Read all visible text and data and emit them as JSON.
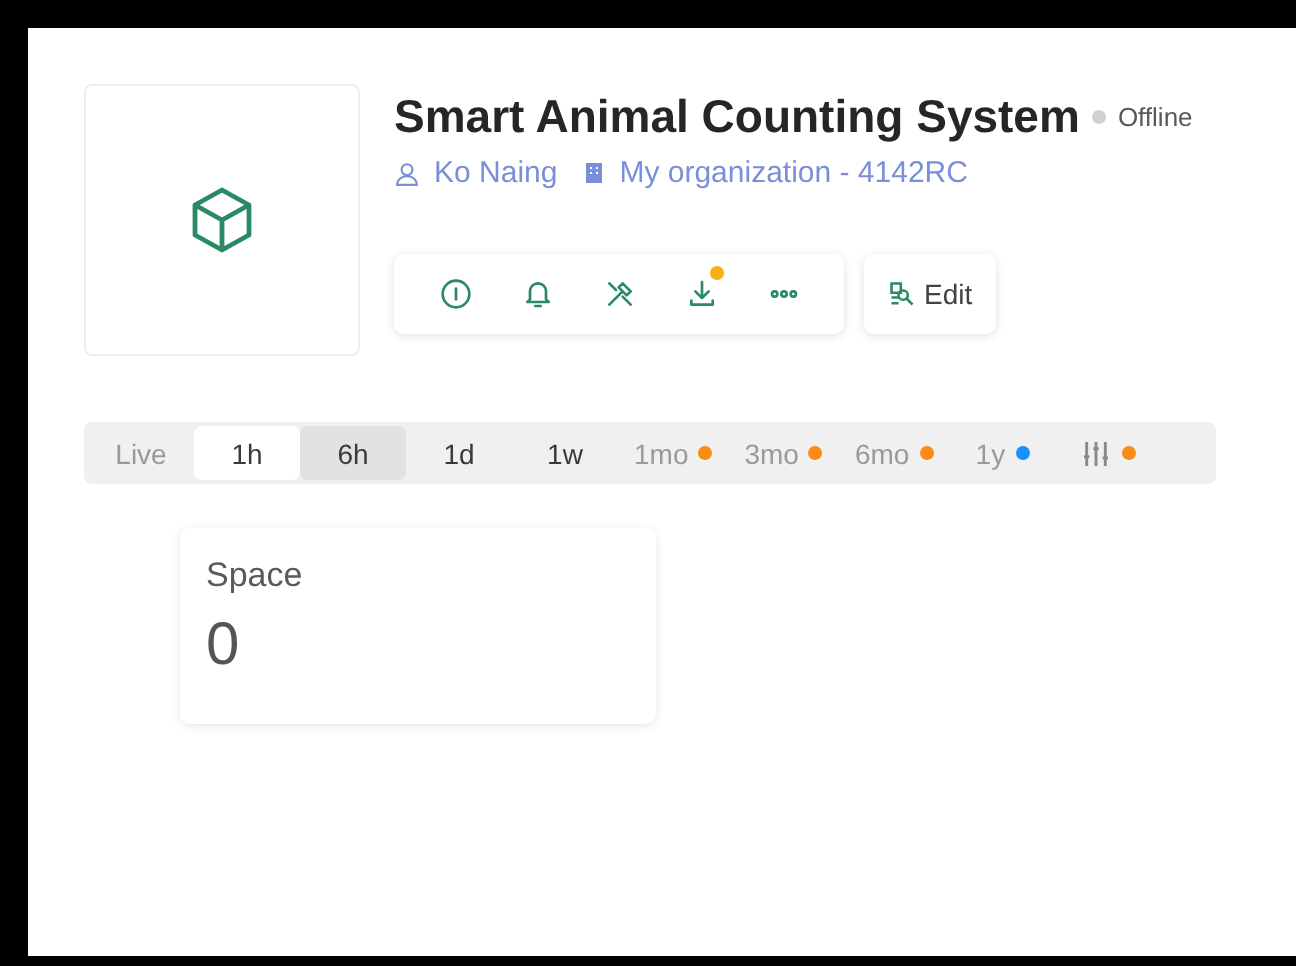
{
  "device": {
    "title": "Smart Animal Counting System",
    "status": "Offline",
    "owner": "Ko Naing",
    "organization": "My organization - 4142RC"
  },
  "actions": [
    {
      "kind": "info",
      "badge": false
    },
    {
      "kind": "bell",
      "badge": false
    },
    {
      "kind": "tools",
      "badge": false
    },
    {
      "kind": "download",
      "badge": true
    },
    {
      "kind": "more",
      "badge": false
    }
  ],
  "edit_button": "Edit",
  "time_ranges": [
    {
      "label": "Live",
      "selected": false,
      "disabled": true
    },
    {
      "label": "1h",
      "selected": true,
      "disabled": false
    },
    {
      "label": "6h",
      "selected": false,
      "disabled": false,
      "hovered": true
    },
    {
      "label": "1d",
      "selected": false,
      "disabled": false
    },
    {
      "label": "1w",
      "selected": false,
      "disabled": false
    },
    {
      "label": "1mo",
      "selected": false,
      "disabled": true,
      "color": "#fa8c16"
    },
    {
      "label": "3mo",
      "selected": false,
      "disabled": true,
      "color": "#fa8c16"
    },
    {
      "label": "6mo",
      "selected": false,
      "disabled": true,
      "color": "#fa8c16"
    },
    {
      "label": "1y",
      "selected": false,
      "disabled": true,
      "color": "#1890ff"
    },
    {
      "kind": "custom",
      "selected": false,
      "disabled": true,
      "color": "#fa8c16"
    }
  ],
  "widgets": [
    {
      "title": "Space",
      "value": "0"
    }
  ]
}
